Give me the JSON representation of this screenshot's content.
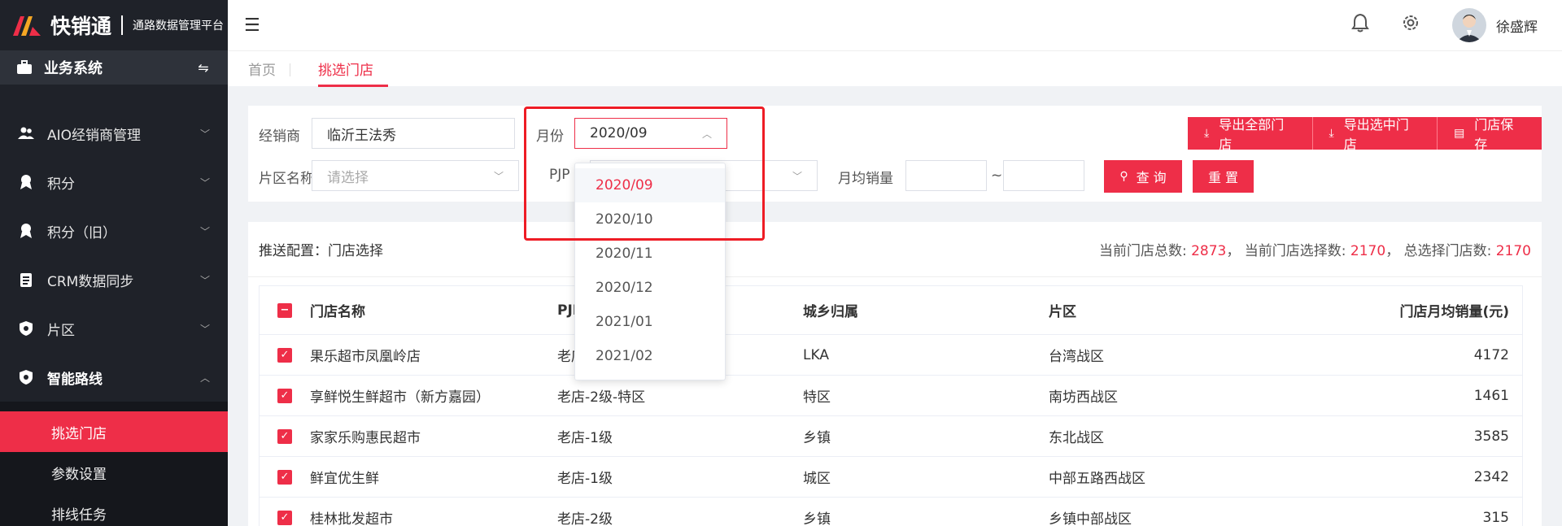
{
  "brand": {
    "name": "快销通",
    "subtitle": "通路数据管理平台"
  },
  "sidebar": {
    "system_label": "业务系统",
    "items": [
      {
        "label": "AIO经销商管理",
        "icon": "users-icon"
      },
      {
        "label": "积分",
        "icon": "award-icon"
      },
      {
        "label": "积分（旧）",
        "icon": "award-icon"
      },
      {
        "label": "CRM数据同步",
        "icon": "clipboard-icon"
      },
      {
        "label": "片区",
        "icon": "shield-icon"
      },
      {
        "label": "智能路线",
        "icon": "shield-icon"
      }
    ],
    "subitems": [
      {
        "label": "挑选门店",
        "active": true
      },
      {
        "label": "参数设置",
        "active": false
      },
      {
        "label": "排线任务",
        "active": false
      }
    ]
  },
  "header": {
    "username": "徐盛辉"
  },
  "tabs": [
    {
      "label": "首页",
      "active": false
    },
    {
      "label": "挑选门店",
      "active": true
    }
  ],
  "filters": {
    "distributor_label": "经销商",
    "distributor_value": "临沂王法秀",
    "month_label": "月份",
    "month_value": "2020/09",
    "area_label": "片区名称",
    "area_placeholder": "请选择",
    "pjp_label": "PJP",
    "avg_sales_label": "月均销量",
    "range_sep": "~",
    "query_label": "查 询",
    "reset_label": "重 置",
    "export_all_label": "导出全部门店",
    "export_selected_label": "导出选中门店",
    "save_label": "门店保存"
  },
  "month_options": [
    "2020/09",
    "2020/10",
    "2020/11",
    "2020/12",
    "2021/01",
    "2021/02"
  ],
  "summary": {
    "title": "推送配置：门店选择",
    "total_label": "当前门店总数:",
    "total_value": "2873",
    "selected_label": "当前门店选择数:",
    "selected_value": "2170",
    "all_selected_label": "总选择门店数:",
    "all_selected_value": "2170",
    "comma": "，"
  },
  "table": {
    "columns": [
      "门店名称",
      "PJP",
      "城乡归属",
      "片区",
      "门店月均销量(元)"
    ],
    "rows": [
      [
        "果乐超市凤凰岭店",
        "老店",
        "LKA",
        "台湾战区",
        "4172"
      ],
      [
        "享鲜悦生鲜超市（新方嘉园）",
        "老店-2级-特区",
        "特区",
        "南坊西战区",
        "1461"
      ],
      [
        "家家乐购惠民超市",
        "老店-1级",
        "乡镇",
        "东北战区",
        "3585"
      ],
      [
        "鲜宜优生鲜",
        "老店-1级",
        "城区",
        "中部五路西战区",
        "2342"
      ],
      [
        "桂林批发超市",
        "老店-2级",
        "乡镇",
        "乡镇中部战区",
        "315"
      ]
    ]
  },
  "colors": {
    "accent": "#ee2e48",
    "sidebar": "#1f2229"
  }
}
